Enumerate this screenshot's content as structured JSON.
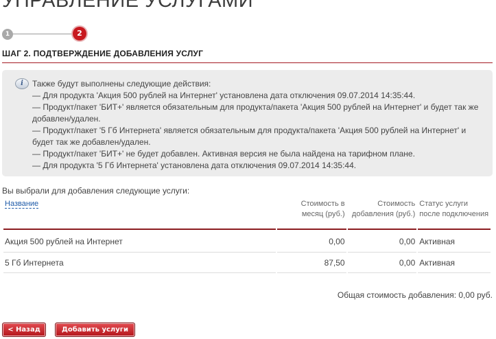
{
  "page": {
    "title": "УПРАВЛЕНИЕ УСЛУГАМИ"
  },
  "steps": {
    "step1": "1",
    "step2": "2",
    "heading": "ШАГ 2. ПОДТВЕРЖДЕНИЕ ДОБАВЛЕНИЯ УСЛУГ"
  },
  "info": {
    "intro": "Также будут выполнены следующие действия:",
    "lines": [
      "— Для продукта 'Акция 500 рублей на Интернет' установлена дата отключения 09.07.2014 14:35:44.",
      "— Продукт/пакет 'БИТ+' является обязательным для продукта/пакета 'Акция 500 рублей на Интернет' и будет так же добавлен/удален.",
      "— Продукт/пакет '5 Гб Интернета' является обязательным для продукта/пакета 'Акция 500 рублей на Интернет' и будет так же добавлен/удален.",
      "— Продукт/пакет 'БИТ+' не будет добавлен. Активная версия не была найдена на тарифном плане.",
      "— Для продукта '5 Гб Интернета' установлена дата отключения 09.07.2014 14:35:44."
    ]
  },
  "selection": {
    "lead": "Вы выбрали для добавления следующие услуги:",
    "columns": {
      "name": "Название",
      "monthly_1": "Стоимость в",
      "monthly_2": "месяц (руб.)",
      "adding_1": "Стоимость",
      "adding_2": "добавления (руб.)",
      "status_1": "Статус услуги",
      "status_2": "после подключения"
    },
    "rows": [
      {
        "name": "Акция 500 рублей на Интернет",
        "monthly": "0,00",
        "adding": "0,00",
        "status": "Активная"
      },
      {
        "name": "5 Гб Интернета",
        "monthly": "87,50",
        "adding": "0,00",
        "status": "Активная"
      }
    ],
    "total": "Общая стоимость добавления: 0,00 руб."
  },
  "buttons": {
    "back": "< Назад",
    "add": "Добавить услуги"
  },
  "colors": {
    "accent": "#c8191f",
    "rule": "#a31a22",
    "info_bg": "#ececec",
    "link": "#1d5aa8"
  },
  "icons": {
    "info": "info-icon"
  }
}
